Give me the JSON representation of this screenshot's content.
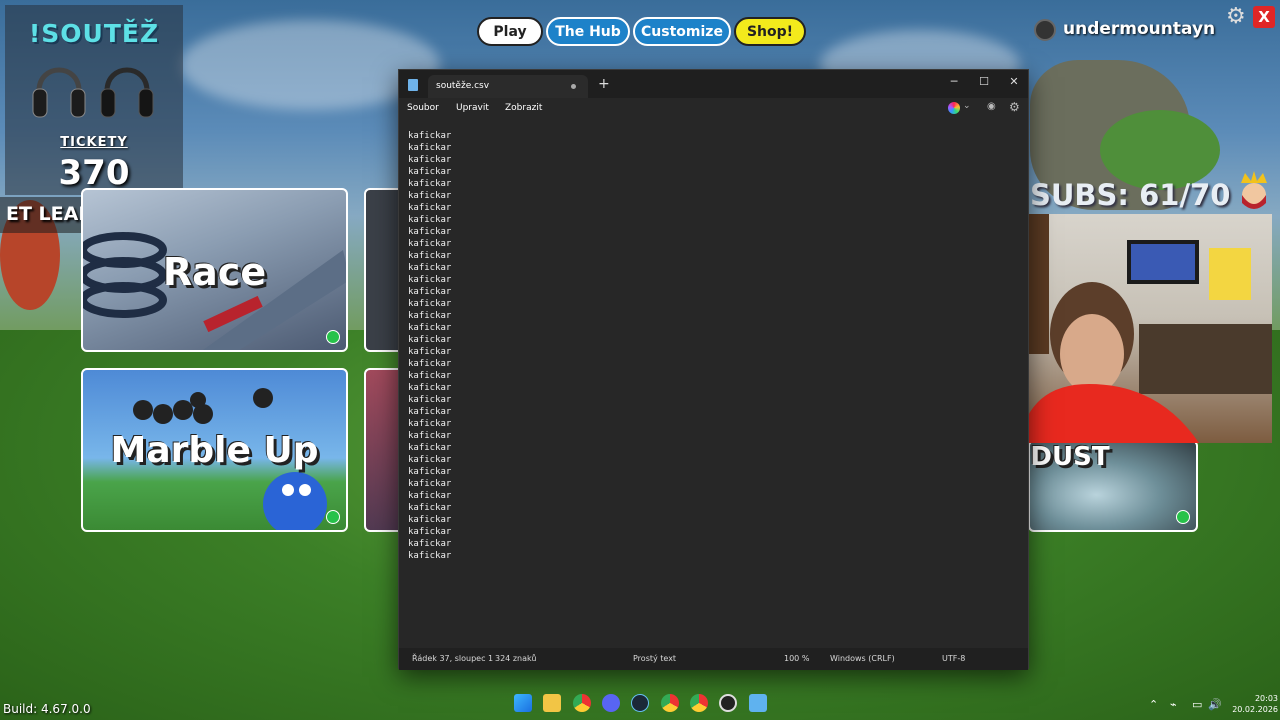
{
  "overlay": {
    "contest_title": "!SOUTĚŽ",
    "tickets_label": "TICKETY",
    "tickets_value": "370",
    "leaderboard_text": "ET LEADER BOAR",
    "subs": "SUBS: 61/70"
  },
  "nav": {
    "play": "Play",
    "hub": "The Hub",
    "customize": "Customize",
    "shop": "Shop!"
  },
  "user": {
    "name": "undermountayn"
  },
  "close_label": "X",
  "tiles": {
    "race": "Race",
    "marble_up": "Marble Up",
    "dust": "DUST"
  },
  "notepad": {
    "tab_title": "soutěže.csv",
    "new_tab": "+",
    "menu": {
      "file": "Soubor",
      "edit": "Upravit",
      "view": "Zobrazit"
    },
    "lines": [
      "kafickar",
      "kafickar",
      "kafickar",
      "kafickar",
      "kafickar",
      "kafickar",
      "kafickar",
      "kafickar",
      "kafickar",
      "kafickar",
      "kafickar",
      "kafickar",
      "kafickar",
      "kafickar",
      "kafickar",
      "kafickar",
      "kafickar",
      "kafickar",
      "kafickar",
      "kafickar",
      "kafickar",
      "kafickar",
      "kafickar",
      "kafickar",
      "kafickar",
      "kafickar",
      "kafickar",
      "kafickar",
      "kafickar",
      "kafickar",
      "kafickar",
      "kafickar",
      "kafickar",
      "kafickar",
      "kafickar",
      "kafickar"
    ],
    "status": {
      "position": "Řádek 37, sloupec 1",
      "chars": "324 znaků",
      "format": "Prostý text",
      "zoom": "100 %",
      "line_ending": "Windows (CRLF)",
      "encoding": "UTF-8"
    }
  },
  "build": "Build: 4.67.0.0",
  "clock": {
    "time": "20:03",
    "date": "20.02.2026"
  },
  "taskbar": {
    "icons": [
      "windows-start",
      "file-explorer",
      "chrome",
      "discord",
      "steam",
      "chrome-profile",
      "chrome-profile-2",
      "obs",
      "notepad"
    ]
  },
  "colors": {
    "contest_title": "#5de0e6",
    "nav_blue": "#1d82c9",
    "shop_yellow": "#f3ea1c",
    "status_dot": "#27c24a",
    "close_red": "#e02626"
  }
}
